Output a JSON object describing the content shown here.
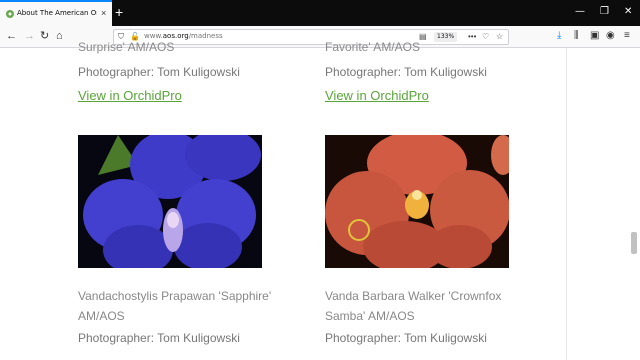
{
  "browser": {
    "tab_title": "About The American Orchid Society",
    "new_tab_symbol": "+",
    "url_prefix": "www.",
    "url_domain": "aos.org",
    "url_path": "/madness",
    "zoom": "133%",
    "window_controls": [
      "—",
      "❐",
      "✕"
    ]
  },
  "cards": [
    {
      "cut_text": "Surprise' AM/AOS",
      "photographer": "Photographer: Tom Kuligowski",
      "link": "View in OrchidPro"
    },
    {
      "cut_text": "Favorite' AM/AOS",
      "photographer": "Photographer: Tom Kuligowski",
      "link": "View in OrchidPro"
    },
    {
      "name_line1": "Vandachostylis Prapawan 'Sapphire'",
      "name_line2": "AM/AOS",
      "photographer": "Photographer: Tom Kuligowski",
      "image_color": "#3f3bc9"
    },
    {
      "name_line1": "Vanda Barbara Walker 'Crownfox",
      "name_line2": "Samba' AM/AOS",
      "photographer": "Photographer: Tom Kuligowski",
      "image_color": "#c8553e"
    }
  ]
}
